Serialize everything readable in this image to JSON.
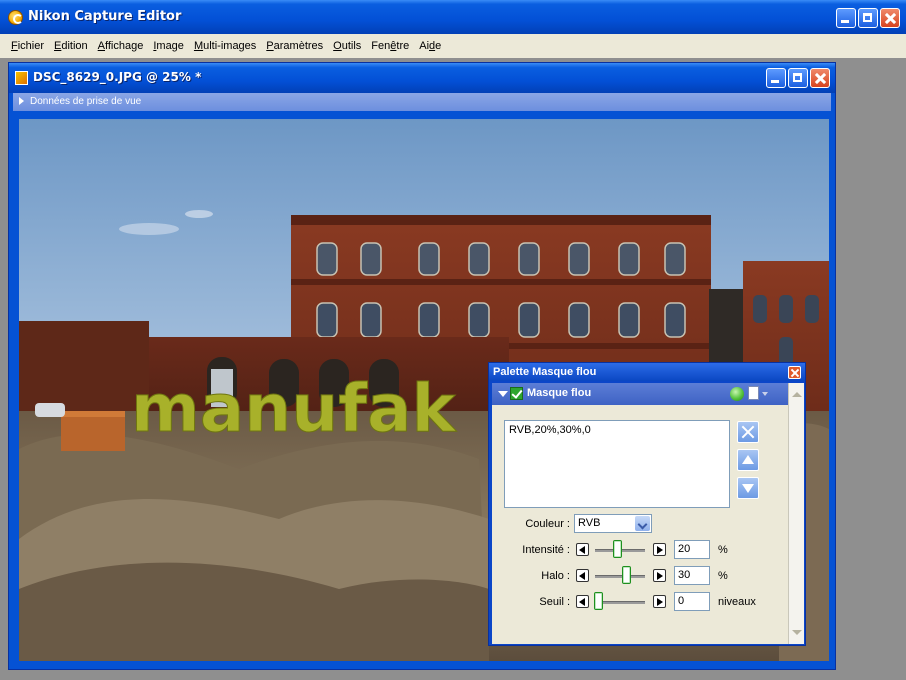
{
  "app": {
    "title": "Nikon Capture Editor"
  },
  "menu": [
    {
      "u": "F",
      "rest": "ichier"
    },
    {
      "u": "E",
      "rest": "dition"
    },
    {
      "u": "A",
      "rest": "ffichage"
    },
    {
      "u": "I",
      "rest": "mage"
    },
    {
      "u": "M",
      "rest": "ulti-images"
    },
    {
      "u": "P",
      "rest": "aramètres"
    },
    {
      "u": "O",
      "rest": "utils"
    },
    {
      "pre": "Fen",
      "u": "ê",
      "rest": "tre"
    },
    {
      "pre": "Ai",
      "u": "d",
      "rest": "e"
    }
  ],
  "document": {
    "title": "DSC_8629_0.JPG @ 25% *",
    "shoot_data_label": "Données de prise de vue"
  },
  "photo": {
    "overlay_text": "manufak"
  },
  "palette": {
    "title": "Palette Masque flou",
    "section_label": "Masque flou",
    "list_entry": "RVB,20%,30%,0",
    "color": {
      "label": "Couleur :",
      "value": "RVB"
    },
    "rows": [
      {
        "key": "intensity",
        "label": "Intensité :",
        "value": "20",
        "unit": "%",
        "level": 0.2
      },
      {
        "key": "halo",
        "label": "Halo :",
        "value": "30",
        "unit": "%",
        "level": 0.3
      },
      {
        "key": "threshold",
        "label": "Seuil :",
        "value": "0",
        "unit": "niveaux",
        "level": 0.0
      }
    ]
  }
}
